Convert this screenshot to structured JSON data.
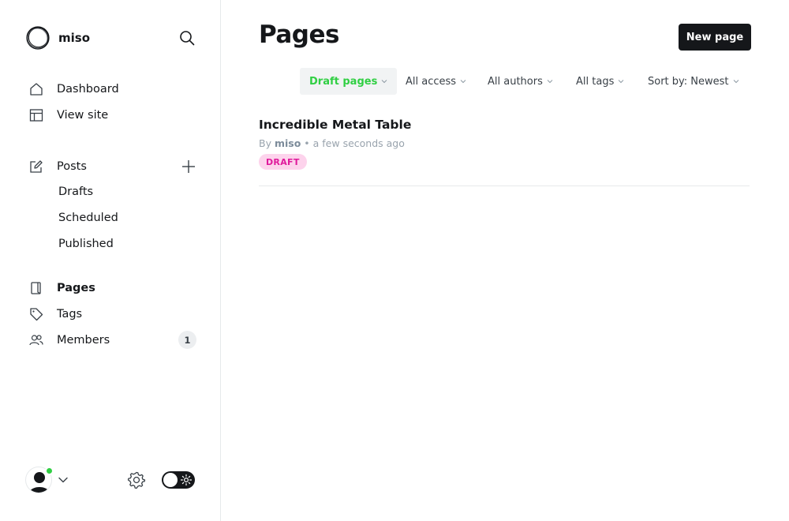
{
  "brand": {
    "name": "miso"
  },
  "nav": {
    "dashboard": "Dashboard",
    "view_site": "View site",
    "posts": "Posts",
    "drafts": "Drafts",
    "scheduled": "Scheduled",
    "published": "Published",
    "pages": "Pages",
    "tags": "Tags",
    "members": "Members",
    "members_count": "1"
  },
  "header": {
    "title": "Pages",
    "new_button": "New page"
  },
  "filters": {
    "type": "Draft pages",
    "access": "All access",
    "authors": "All authors",
    "tags": "All tags",
    "sort": "Sort by: Newest"
  },
  "posts": [
    {
      "title": "Incredible Metal Table",
      "by": "By",
      "author": "miso",
      "time": "• a few seconds ago",
      "status": "DRAFT"
    }
  ],
  "colors": {
    "accent_green": "#30cf43",
    "draft_pink": "#e01a9c",
    "dark": "#15171a"
  }
}
